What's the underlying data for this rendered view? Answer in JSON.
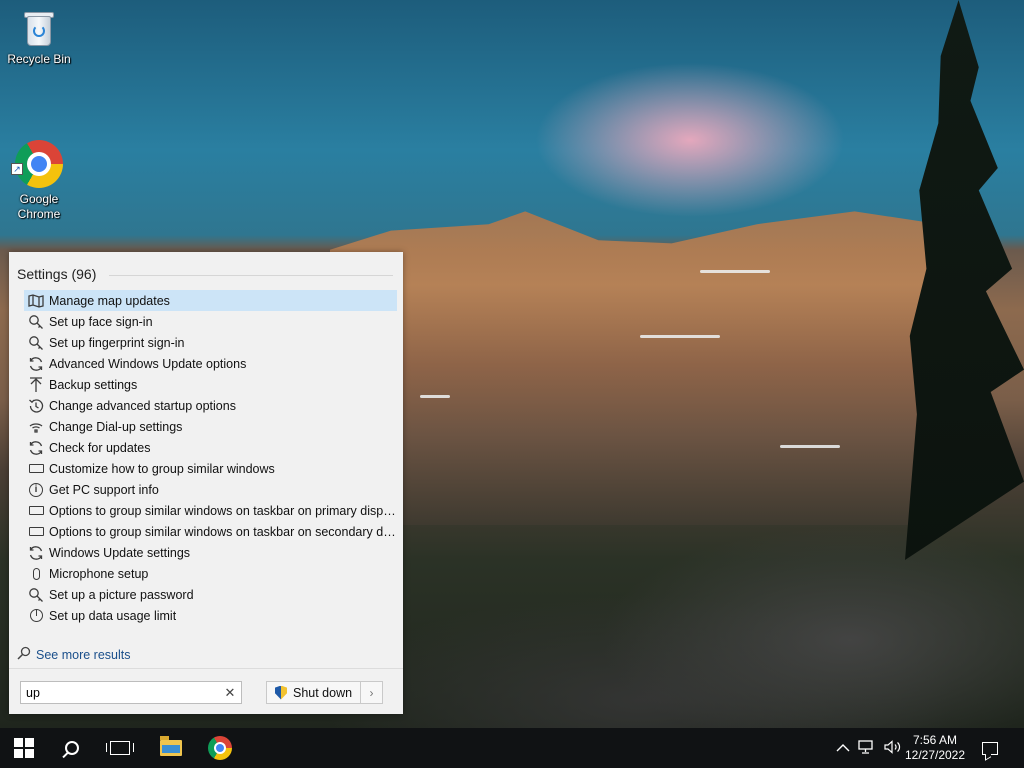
{
  "desktop": {
    "icons": [
      {
        "label": "Recycle Bin",
        "icon": "recycle-bin-icon"
      },
      {
        "label": "Google\nChrome",
        "icon": "chrome-icon"
      }
    ]
  },
  "search_panel": {
    "section_title": "Settings (96)",
    "results": [
      {
        "label": "Manage map updates",
        "icon": "map-icon",
        "selected": true
      },
      {
        "label": "Set up face sign-in",
        "icon": "key-search-icon"
      },
      {
        "label": "Set up fingerprint sign-in",
        "icon": "key-search-icon"
      },
      {
        "label": "Advanced Windows Update options",
        "icon": "sync-icon"
      },
      {
        "label": "Backup settings",
        "icon": "upload-arrow-icon"
      },
      {
        "label": "Change advanced startup options",
        "icon": "history-icon"
      },
      {
        "label": "Change Dial-up settings",
        "icon": "dialup-icon"
      },
      {
        "label": "Check for updates",
        "icon": "sync-icon"
      },
      {
        "label": "Customize how to group similar windows",
        "icon": "taskbar-icon"
      },
      {
        "label": "Get PC support info",
        "icon": "info-icon"
      },
      {
        "label": "Options to group similar windows on taskbar on primary display",
        "icon": "taskbar-icon"
      },
      {
        "label": "Options to group similar windows on taskbar on secondary dis...",
        "icon": "taskbar-icon"
      },
      {
        "label": "Windows Update settings",
        "icon": "sync-icon"
      },
      {
        "label": "Microphone setup",
        "icon": "microphone-icon"
      },
      {
        "label": "Set up a picture password",
        "icon": "key-search-icon"
      },
      {
        "label": "Set up data usage limit",
        "icon": "pie-chart-icon"
      }
    ],
    "see_more": "See more results",
    "search_value": "up",
    "shutdown_label": "Shut down"
  },
  "taskbar": {
    "time": "7:56 AM",
    "date": "12/27/2022"
  },
  "colors": {
    "selected_row": "#cce4f7",
    "panel_bg": "#f1f1f1",
    "taskbar_bg": "#101214",
    "link": "#1a4f8b"
  }
}
